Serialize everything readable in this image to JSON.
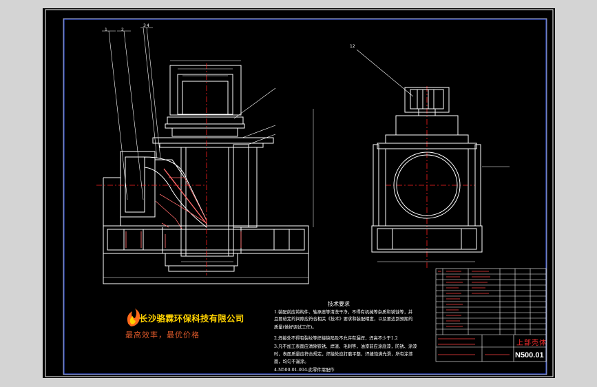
{
  "company": {
    "name": "长沙骆霖环保科技有限公司",
    "slogan": "最高效率，最优价格"
  },
  "technical_requirements": {
    "title": "技术要求",
    "items": [
      "1.装配前应将构件、轴承座等清洗干净，不得有机械等杂质和锈蚀等，并",
      "且要给定的间隙应符合相关《技术》要求和装配精度，以及要达到预期的",
      "质量(做好调试工作)。",
      "2.焊接处不得有裂纹等焊接缺陷及不允许有漏焊，焊高不少于1.2",
      "3.凡不加工表面应清除铁锈、焊渣、毛刺等，油漆前应涂底漆，防锈、涂漆",
      "时，表面质量应符合规定，焊接处应打磨平整，焊缝饱满光滑，所有涂漆",
      "面，均匀不漏涂。",
      "4.N500-01-004.此零件需配作"
    ]
  },
  "title_block": {
    "part_name": "上部壳体",
    "drawing_number": "N500.01"
  },
  "callouts": [
    "1",
    "2",
    "3",
    "4",
    "12"
  ],
  "colors": {
    "background": "#d4d4d4",
    "sheet": "#000000",
    "frame": "#ffffff",
    "outline": "#ffffff",
    "center_line": "#ff2020",
    "dimension": "#ffffff",
    "section_fill": "#ff6a6a",
    "company_text": "#ffd200",
    "slogan_text": "#e05a2a"
  }
}
